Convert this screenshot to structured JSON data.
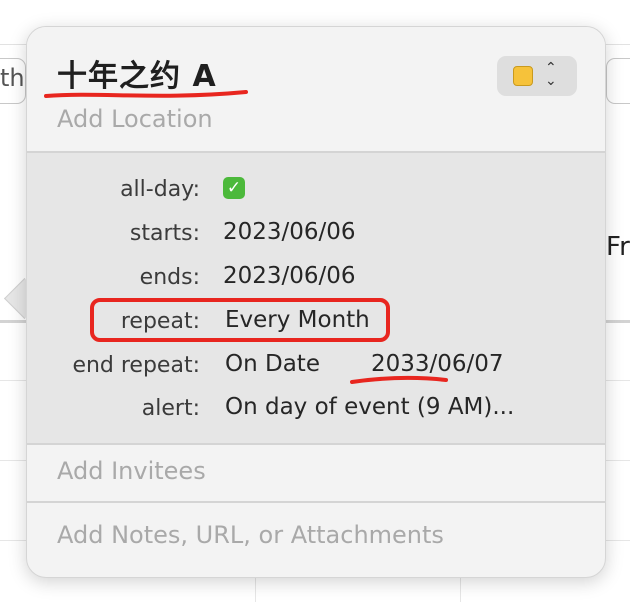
{
  "background": {
    "search_text": "th",
    "day_label": "Fr"
  },
  "event": {
    "title": "十年之约 A",
    "location_placeholder": "Add Location",
    "color": "#f6c23a"
  },
  "details": {
    "all_day_label": "all-day:",
    "all_day_checked": true,
    "starts_label": "starts:",
    "starts_value": "2023/06/06",
    "ends_label": "ends:",
    "ends_value": "2023/06/06",
    "repeat_label": "repeat:",
    "repeat_value": "Every Month",
    "end_repeat_label": "end repeat:",
    "end_repeat_mode": "On Date",
    "end_repeat_date": "2033/06/07",
    "alert_label": "alert:",
    "alert_value": "On day of event (9 AM)..."
  },
  "invitees_placeholder": "Add Invitees",
  "notes_placeholder": "Add Notes, URL, or Attachments",
  "annotation_color": "#e8261f"
}
